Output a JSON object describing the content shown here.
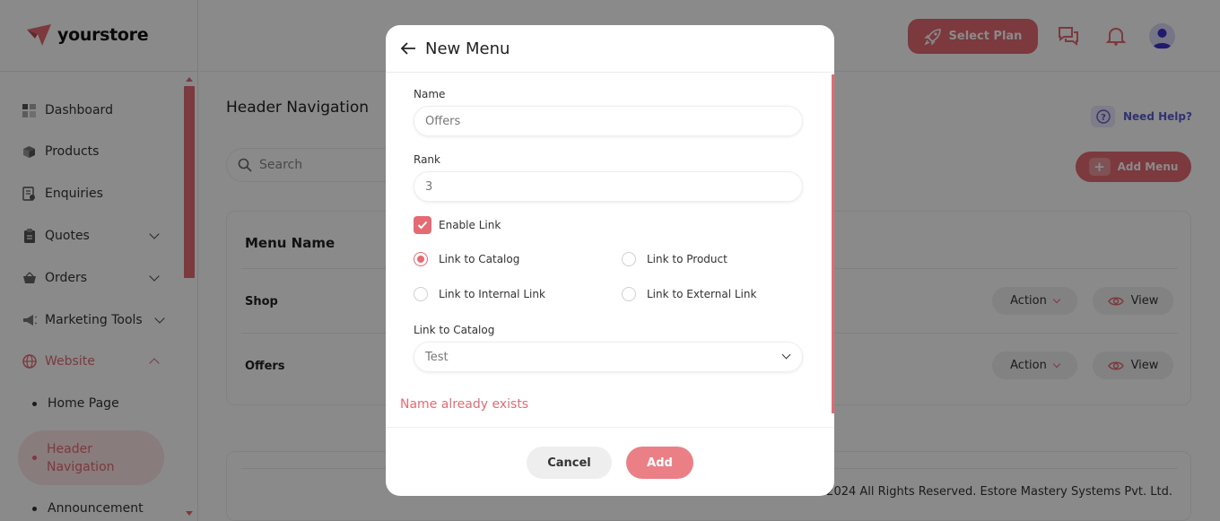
{
  "app": {
    "logo_text": "yourstore"
  },
  "sidebar": {
    "items": [
      {
        "label": "Dashboard",
        "icon": "dashboard-icon"
      },
      {
        "label": "Products",
        "icon": "box-icon"
      },
      {
        "label": "Enquiries",
        "icon": "document-icon"
      },
      {
        "label": "Quotes",
        "icon": "clipboard-icon"
      },
      {
        "label": "Orders",
        "icon": "basket-icon"
      },
      {
        "label": "Marketing Tools",
        "icon": "megaphone-icon"
      },
      {
        "label": "Website",
        "icon": "globe-icon"
      }
    ],
    "sub_items": [
      {
        "label": "Home Page"
      },
      {
        "label": "Header Navigation"
      },
      {
        "label": "Announcement"
      }
    ]
  },
  "topbar": {
    "select_plan_label": "Select Plan"
  },
  "page": {
    "title": "Header Navigation",
    "need_help": "Need Help?",
    "search_placeholder": "Search",
    "add_menu_label": "Add Menu",
    "table": {
      "header": "Menu Name",
      "rows": [
        {
          "name": "Shop",
          "action": "Action",
          "view": "View"
        },
        {
          "name": "Offers",
          "action": "Action",
          "view": "View"
        }
      ]
    },
    "footer_text": "2024 All Rights Reserved. Estore Mastery Systems Pvt. Ltd."
  },
  "modal": {
    "title": "New Menu",
    "name_label": "Name",
    "name_value": "Offers",
    "rank_label": "Rank",
    "rank_value": "3",
    "enable_link_label": "Enable Link",
    "enable_link_checked": true,
    "radios": [
      {
        "label": "Link to Catalog",
        "selected": true
      },
      {
        "label": "Link to Product",
        "selected": false
      },
      {
        "label": "Link to Internal Link",
        "selected": false
      },
      {
        "label": "Link to External Link",
        "selected": false
      }
    ],
    "catalog_label": "Link to Catalog",
    "catalog_value": "Test",
    "error_text": "Name already exists",
    "cancel_label": "Cancel",
    "add_label": "Add"
  },
  "colors": {
    "accent": "#e56a73",
    "help": "#5b5bd6"
  }
}
